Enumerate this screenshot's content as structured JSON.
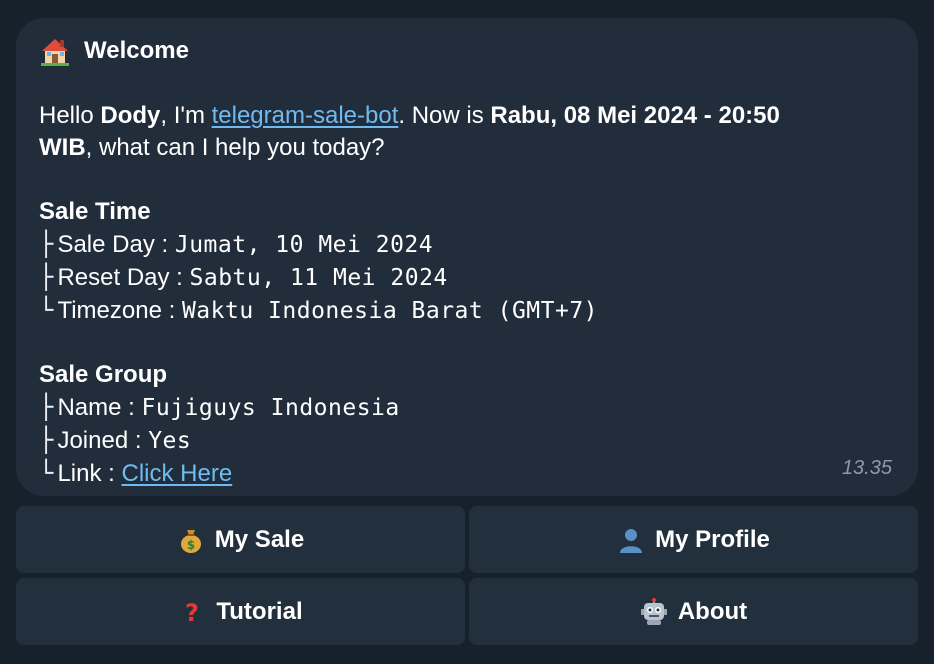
{
  "message": {
    "title": "Welcome",
    "greeting": {
      "hello": "Hello ",
      "user": "Dody",
      "im": ", I'm ",
      "bot_link": "telegram-sale-bot",
      "now_is": ". Now is ",
      "datetime_a": "Rabu, 08 Mei 2024 - 20:50",
      "datetime_b": "WIB",
      "question": ", what can I help you today?"
    },
    "sale_time": {
      "heading": "Sale Time",
      "rows": [
        {
          "branch": "├",
          "label": "Sale Day",
          "sep": " : ",
          "value": "Jumat, 10 Mei 2024"
        },
        {
          "branch": "├",
          "label": "Reset Day",
          "sep": " : ",
          "value": "Sabtu, 11 Mei 2024"
        },
        {
          "branch": "└",
          "label": "Timezone",
          "sep": " : ",
          "value": "Waktu Indonesia Barat (GMT+7)"
        }
      ]
    },
    "sale_group": {
      "heading": "Sale Group",
      "rows": [
        {
          "branch": "├",
          "label": "Name",
          "sep": " : ",
          "value": "Fujiguys Indonesia"
        },
        {
          "branch": "├",
          "label": "Joined",
          "sep": " : ",
          "value": "Yes"
        },
        {
          "branch": "└",
          "label": "Link",
          "sep": " : ",
          "value": "Click Here"
        }
      ]
    },
    "timestamp": "13.35"
  },
  "keyboard": {
    "my_sale": {
      "label": "My Sale",
      "icon": "money-bag-icon"
    },
    "my_profile": {
      "label": "My Profile",
      "icon": "user-silhouette-icon"
    },
    "tutorial": {
      "label": "Tutorial",
      "icon": "question-mark-icon"
    },
    "about": {
      "label": "About",
      "icon": "robot-icon"
    }
  },
  "colors": {
    "background": "#17212b",
    "bubble": "#212d3b",
    "button": "#222f3d",
    "link": "#71baf0",
    "timestamp": "#8c9aa8"
  }
}
